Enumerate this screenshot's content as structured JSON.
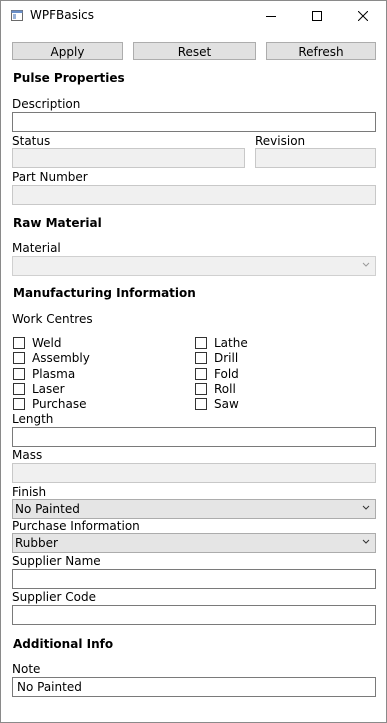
{
  "window": {
    "title": "WPFBasics",
    "icon": "app-window-icon"
  },
  "toolbar": {
    "apply": "Apply",
    "reset": "Reset",
    "refresh": "Refresh"
  },
  "pulse": {
    "header": "Pulse Properties",
    "description_label": "Description",
    "description_value": "",
    "status_label": "Status",
    "status_value": "",
    "revision_label": "Revision",
    "revision_value": "",
    "part_number_label": "Part Number",
    "part_number_value": ""
  },
  "raw": {
    "header": "Raw Material",
    "material_label": "Material",
    "material_value": ""
  },
  "manufacturing": {
    "header": "Manufacturing Information",
    "work_centres_label": "Work Centres",
    "left": [
      {
        "label": "Weld",
        "checked": false
      },
      {
        "label": "Assembly",
        "checked": false
      },
      {
        "label": "Plasma",
        "checked": false
      },
      {
        "label": "Laser",
        "checked": false
      },
      {
        "label": "Purchase",
        "checked": false
      }
    ],
    "right": [
      {
        "label": "Lathe",
        "checked": false
      },
      {
        "label": "Drill",
        "checked": false
      },
      {
        "label": "Fold",
        "checked": false
      },
      {
        "label": "Roll",
        "checked": false
      },
      {
        "label": "Saw",
        "checked": false
      }
    ],
    "length_label": "Length",
    "length_value": "",
    "mass_label": "Mass",
    "mass_value": "",
    "finish_label": "Finish",
    "finish_value": "No Painted",
    "purchase_label": "Purchase Information",
    "purchase_value": "Rubber",
    "supplier_name_label": "Supplier Name",
    "supplier_name_value": "",
    "supplier_code_label": "Supplier Code",
    "supplier_code_value": ""
  },
  "additional": {
    "header": "Additional Info",
    "note_label": "Note",
    "note_value": "No Painted"
  }
}
